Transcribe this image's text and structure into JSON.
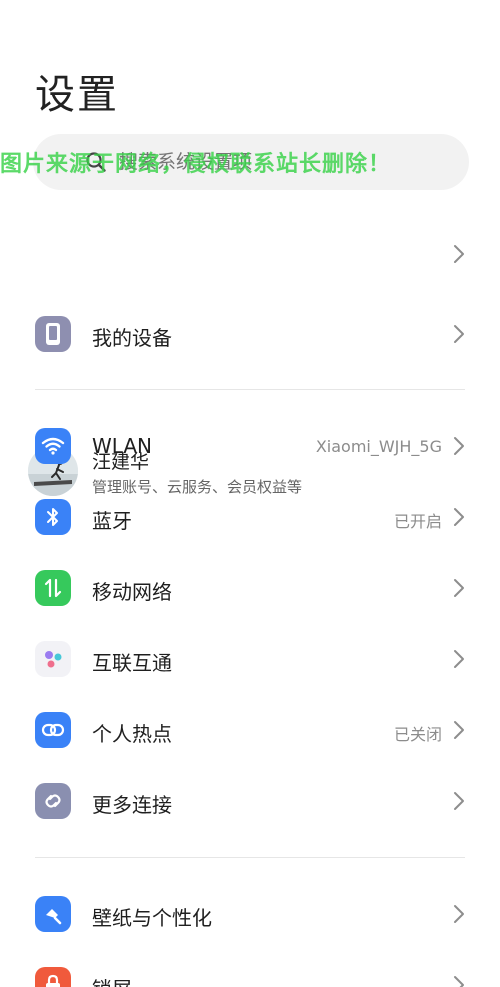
{
  "header": {
    "title": "设置"
  },
  "search": {
    "placeholder": "搜索系统设置项"
  },
  "watermark": {
    "text": "图片来源于网络，侵权联系站长删除！"
  },
  "account": {
    "name": "汪建华",
    "subtitle": "管理账号、云服务、会员权益等"
  },
  "device": {
    "label": "我的设备"
  },
  "connectivity": [
    {
      "key": "wlan",
      "label": "WLAN",
      "value": "Xiaomi_WJH_5G",
      "icon": "wifi-icon",
      "color": "#3a82f7"
    },
    {
      "key": "bluetooth",
      "label": "蓝牙",
      "value": "已开启",
      "icon": "bluetooth-icon",
      "color": "#3a82f7"
    },
    {
      "key": "mobile",
      "label": "移动网络",
      "value": "",
      "icon": "mobile-data-icon",
      "color": "#36c95c"
    },
    {
      "key": "interconnect",
      "label": "互联互通",
      "value": "",
      "icon": "interconnect-icon",
      "color": "#f2f2f6"
    },
    {
      "key": "hotspot",
      "label": "个人热点",
      "value": "已关闭",
      "icon": "hotspot-icon",
      "color": "#3a82f7"
    },
    {
      "key": "more",
      "label": "更多连接",
      "value": "",
      "icon": "link-icon",
      "color": "#8a8fb0"
    }
  ],
  "personal": [
    {
      "key": "wallpaper",
      "label": "壁纸与个性化",
      "icon": "wallpaper-icon",
      "color": "#3a82f7"
    },
    {
      "key": "lockscreen",
      "label": "锁屏",
      "icon": "lock-icon",
      "color": "#f05a3c"
    }
  ]
}
